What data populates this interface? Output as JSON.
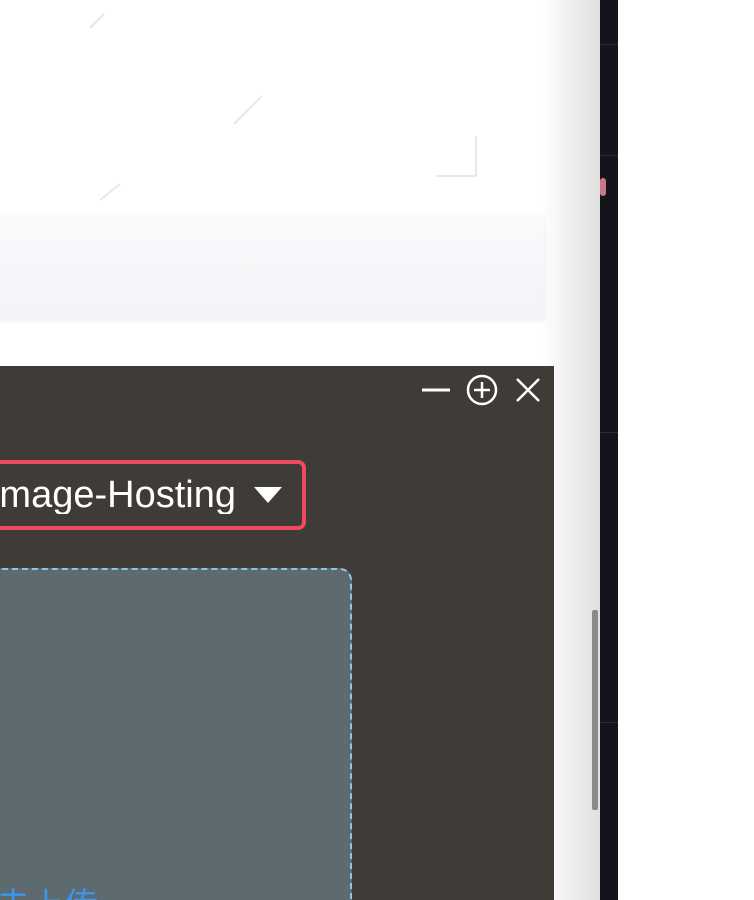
{
  "uploader": {
    "host_selector_label": "Image-Hosting",
    "upload_link_text": "点击上传",
    "controls": {
      "minimize_icon": "minimize-icon",
      "zoom_icon": "zoom-in-icon",
      "close_icon": "close-icon"
    },
    "colors": {
      "window_bg": "#3f3b37",
      "selector_border": "#ee4c5c",
      "drop_zone_bg": "#5d6a70",
      "drop_zone_border": "#8fc4ea",
      "link": "#3c95e8"
    }
  }
}
